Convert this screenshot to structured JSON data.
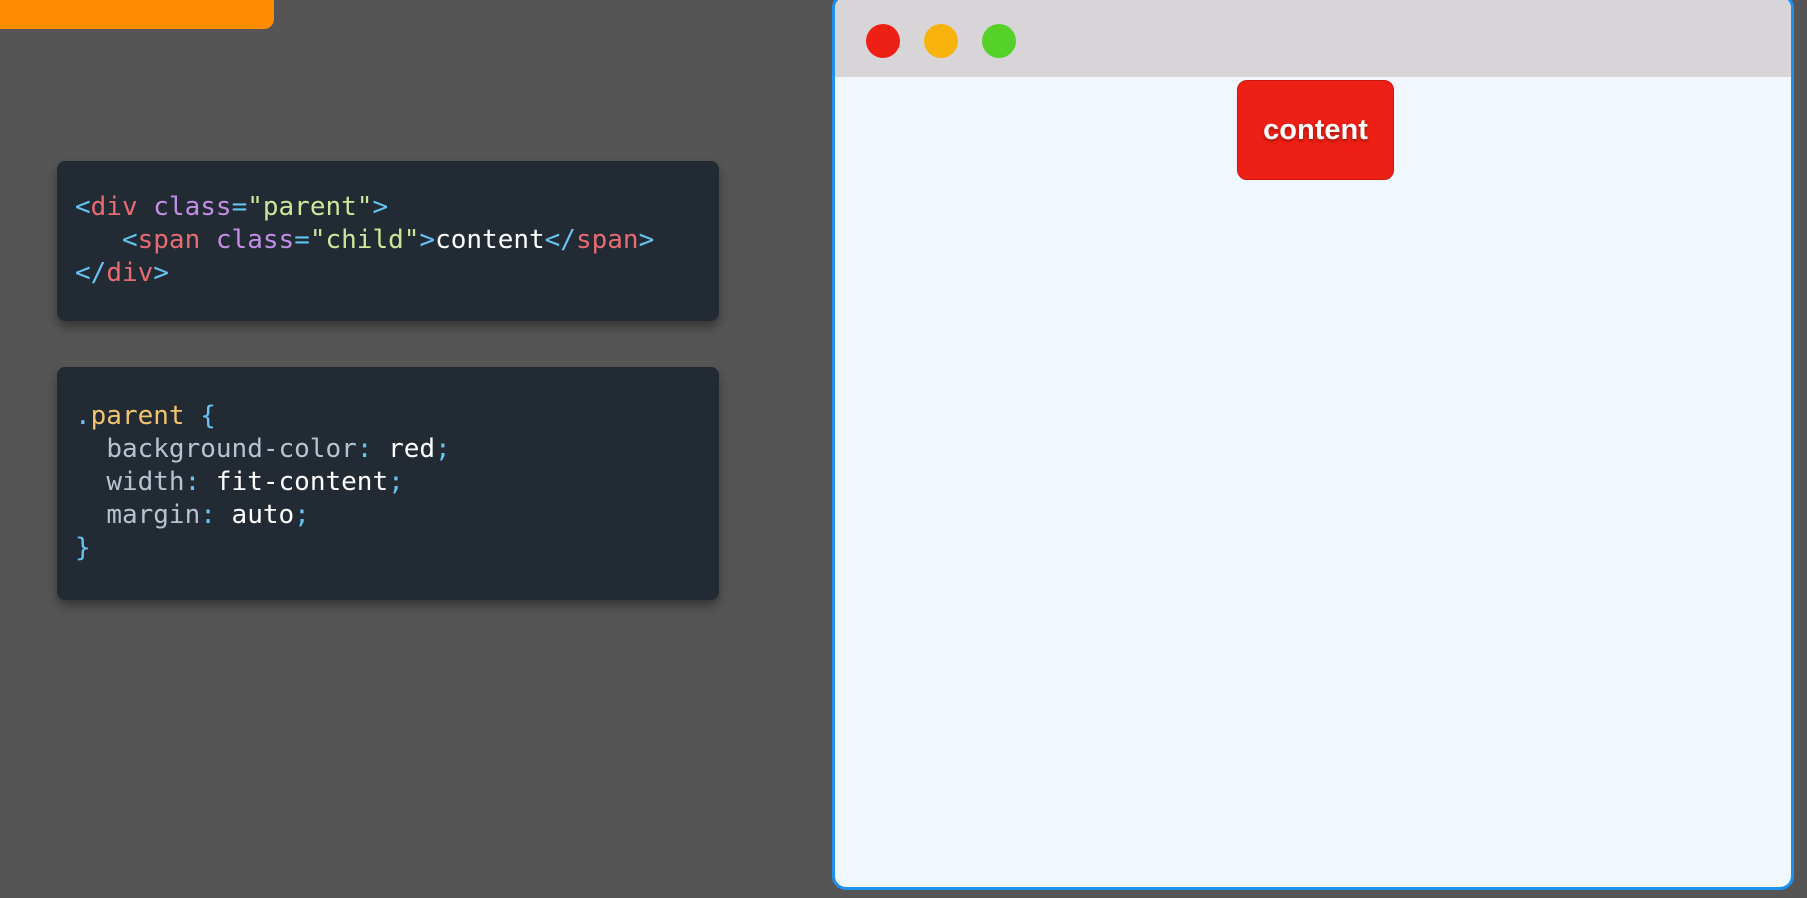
{
  "html_code": {
    "line1": {
      "open_bracket": "<",
      "tag": "div",
      "attr": "class",
      "eq": "=",
      "string": "\"parent\"",
      "close_bracket": ">"
    },
    "line2": {
      "indent": "   ",
      "open_bracket": "<",
      "tag": "span",
      "attr": "class",
      "eq": "=",
      "string": "\"child\"",
      "close_bracket": ">",
      "text": "content",
      "end_open": "</",
      "end_tag": "span",
      "end_close": ">"
    },
    "line3": {
      "end_open": "</",
      "tag": "div",
      "end_close": ">"
    }
  },
  "css_code": {
    "selector_dot": ".",
    "selector": "parent",
    "open_brace": "{",
    "declarations": [
      {
        "indent": "  ",
        "property": "background-color",
        "colon": ":",
        "value": "red",
        "semicolon": ";"
      },
      {
        "indent": "  ",
        "property": "width",
        "colon": ":",
        "value": "fit-content",
        "semicolon": ";"
      },
      {
        "indent": "  ",
        "property": "margin",
        "colon": ":",
        "value": "auto",
        "semicolon": ";"
      }
    ],
    "close_brace": "}"
  },
  "preview": {
    "traffic_lights": [
      "close",
      "minimize",
      "maximize"
    ],
    "child_text": "content"
  },
  "colors": {
    "background": "#555555",
    "orange_tab": "#ff8c00",
    "code_bg": "#222a33",
    "browser_border": "#1e90ef",
    "titlebar": "#d8d5d8",
    "viewport": "#f0f7ff",
    "red": "#ee1f14",
    "yellow": "#f7b30c",
    "green": "#55d12a"
  }
}
